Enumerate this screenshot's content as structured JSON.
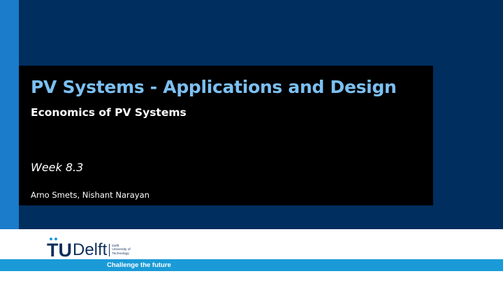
{
  "slide": {
    "title": "PV Systems - Applications and Design",
    "subtitle": "Economics of PV Systems",
    "week": "Week 8.3",
    "authors": "Arno Smets, Nishant Narayan"
  },
  "logo": {
    "mark": "TU",
    "name": "Delft",
    "sub_line1": "Delft",
    "sub_line2": "University of",
    "sub_line3": "Technology"
  },
  "footer": {
    "tagline": "Challenge the future"
  },
  "colors": {
    "background": "#002e5e",
    "accent": "#1a7ccb",
    "title": "#7cc0f2",
    "footer_bar": "#1a9bd7"
  }
}
